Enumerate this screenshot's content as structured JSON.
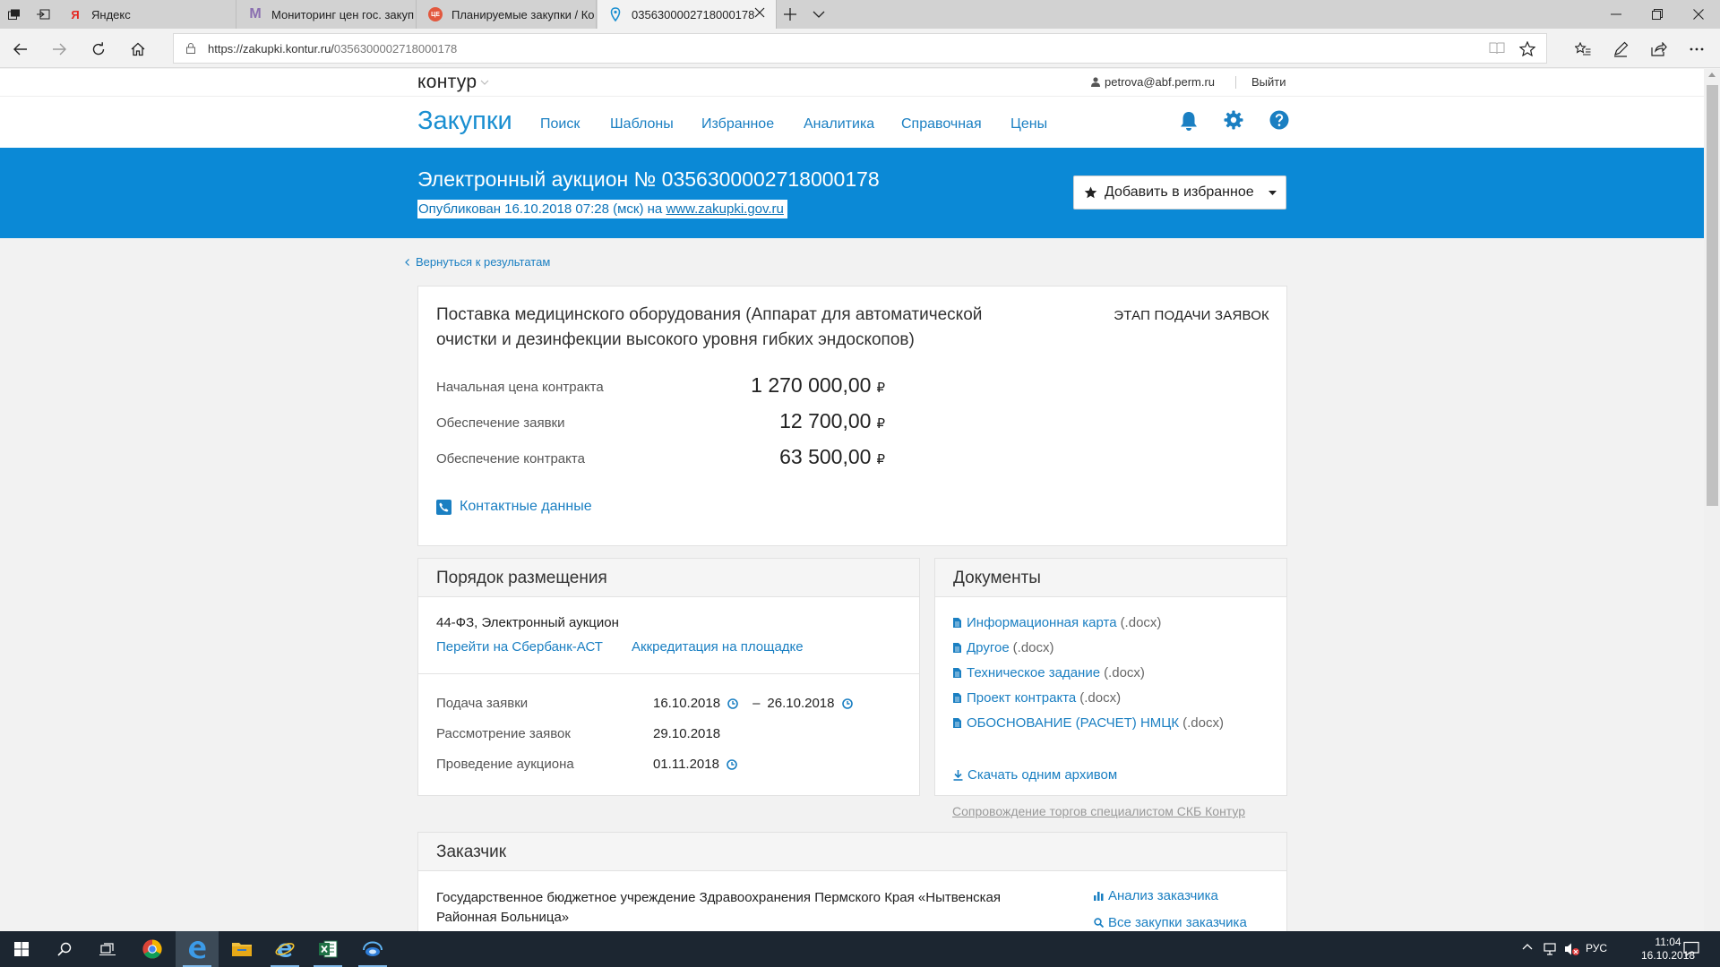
{
  "browser": {
    "tabs": [
      {
        "title": "Яндекс",
        "favicon": "Я"
      },
      {
        "title": "Мониторинг цен гос. закуп",
        "favicon": "M"
      },
      {
        "title": "Планируемые закупки / Ко",
        "favicon": "ЦЕ"
      },
      {
        "title": "0356300002718000178",
        "favicon": "location-pin-icon"
      }
    ],
    "url_host": "https://zakupki.kontur.ru/",
    "url_path": "0356300002718000178"
  },
  "site": {
    "logo": "контур",
    "user_email": "petrova@abf.perm.ru",
    "logout": "Выйти",
    "brand": "Закупки",
    "nav": [
      "Поиск",
      "Шаблоны",
      "Избранное",
      "Аналитика",
      "Справочная",
      "Цены"
    ]
  },
  "hero": {
    "title": "Электронный аукцион № 0356300002718000178",
    "published_prefix": "Опубликован 16.10.2018 07:28 (мск) на ",
    "published_link": "www.zakupki.gov.ru",
    "favorite_button": "Добавить в избранное"
  },
  "back_link": "Вернуться к результатам",
  "purchase": {
    "title": "Поставка медицинского оборудования (Аппарат для автоматической очистки и дезинфекции высокого уровня гибких эндоскопов)",
    "stage": "ЭТАП ПОДАЧИ ЗАЯВОК",
    "prices": [
      {
        "label": "Начальная цена контракта",
        "value": "1 270 000,00"
      },
      {
        "label": "Обеспечение заявки",
        "value": "12 700,00"
      },
      {
        "label": "Обеспечение контракта",
        "value": "63 500,00"
      }
    ],
    "currency": "₽",
    "contacts": "Контактные данные"
  },
  "procedure": {
    "heading": "Порядок размещения",
    "law": "44-ФЗ, Электронный аукцион",
    "link_platform": "Перейти на Сбербанк-АСТ",
    "link_accreditation": "Аккредитация на площадке",
    "dates": [
      {
        "label": "Подача заявки",
        "from": "16.10.2018",
        "to": "26.10.2018",
        "dash": "–"
      },
      {
        "label": "Рассмотрение заявок",
        "from": "29.10.2018"
      },
      {
        "label": "Проведение аукциона",
        "from": "01.11.2018"
      }
    ]
  },
  "documents": {
    "heading": "Документы",
    "items": [
      {
        "name": "Информационная карта",
        "ext": "(.docx)"
      },
      {
        "name": "Другое",
        "ext": "(.docx)"
      },
      {
        "name": "Техническое задание",
        "ext": "(.docx)"
      },
      {
        "name": "Проект контракта",
        "ext": "(.docx)"
      },
      {
        "name": "ОБОСНОВАНИЕ (РАСЧЕТ) НМЦК",
        "ext": "(.docx)"
      }
    ],
    "archive": "Скачать одним архивом"
  },
  "support_link": "Сопровождение торгов специалистом СКБ Контур",
  "customer": {
    "heading": "Заказчик",
    "name": "Государственное бюджетное учреждение Здравоохранения Пермского Края «Нытвенская Районная Больница»",
    "analysis": "Анализ заказчика",
    "all_purchases": "Все закупки заказчика"
  },
  "taskbar": {
    "lang": "РУС",
    "time": "11:04",
    "date": "16.10.2018"
  },
  "colors": {
    "brand_blue": "#0b89d6",
    "link_blue": "#1a7fc2",
    "taskbar": "#1c2631"
  }
}
